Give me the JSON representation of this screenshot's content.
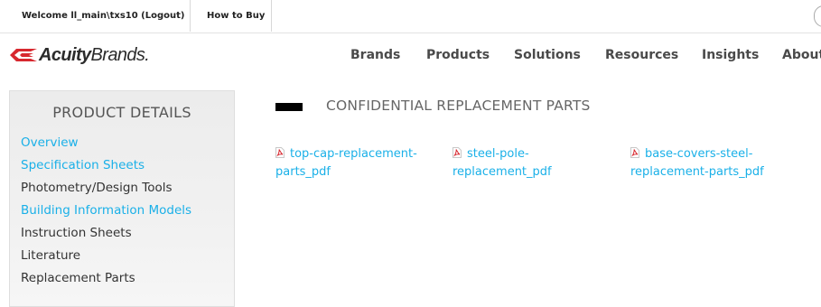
{
  "topbar": {
    "welcome_text": "Welcome ll_main\\txs10 (Logout)",
    "how_to_buy": "How to Buy"
  },
  "header": {
    "logo": {
      "word1": "Acuity",
      "word2": "Brands."
    },
    "nav": [
      "Brands",
      "Products",
      "Solutions",
      "Resources",
      "Insights",
      "About"
    ]
  },
  "sidebar": {
    "title": "PRODUCT DETAILS",
    "items": [
      {
        "label": "Overview",
        "is_link": true
      },
      {
        "label": "Specification Sheets",
        "is_link": true
      },
      {
        "label": "Photometry/Design Tools",
        "is_link": false
      },
      {
        "label": "Building Information Models",
        "is_link": true
      },
      {
        "label": "Instruction Sheets",
        "is_link": false
      },
      {
        "label": "Literature",
        "is_link": false
      },
      {
        "label": "Replacement Parts",
        "is_link": false
      }
    ]
  },
  "main": {
    "section_title": "CONFIDENTIAL REPLACEMENT PARTS",
    "files": [
      {
        "line1": "top-cap-replacement-",
        "line2": "parts_pdf",
        "icon": "pdf-icon"
      },
      {
        "line1": "steel-pole-",
        "line2": "replacement_pdf",
        "icon": "pdf-icon"
      },
      {
        "line1": "base-covers-steel-",
        "line2": "replacement-parts_pdf",
        "icon": "pdf-icon"
      }
    ]
  },
  "colors": {
    "link": "#1ab0e8",
    "logo_red": "#d7282f",
    "nav_text": "#4a4a4a",
    "sidebar_bg": "#ececec"
  }
}
